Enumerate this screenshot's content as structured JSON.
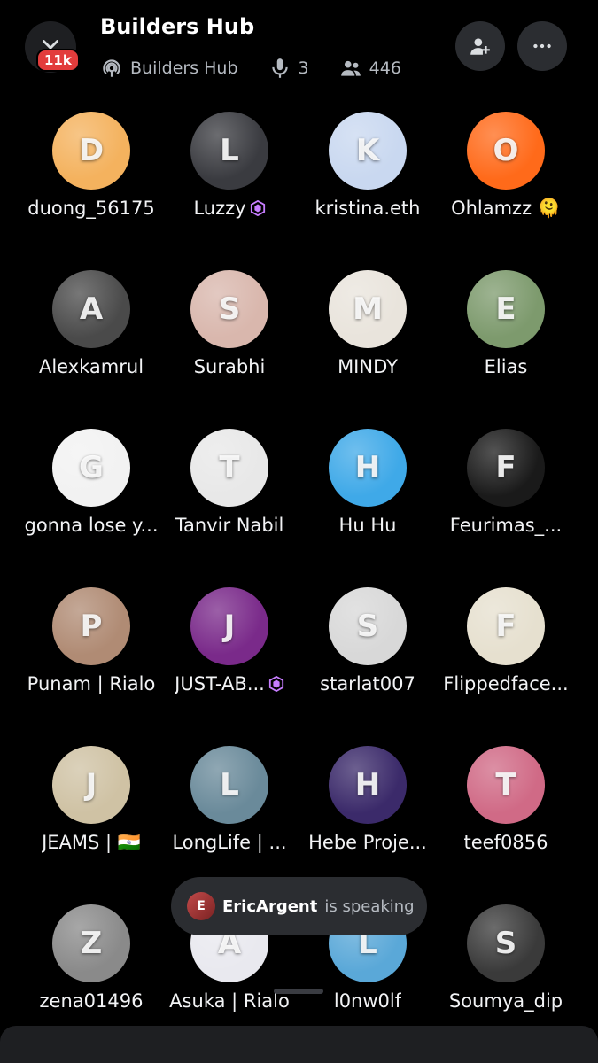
{
  "header": {
    "title": "Builders Hub",
    "badge": "11k",
    "stage_name": "Builders Hub",
    "speaker_count": "3",
    "listener_count": "446"
  },
  "participants": [
    {
      "name": "duong_56175",
      "color": "#f4b25e",
      "initial": "D",
      "nitro": false
    },
    {
      "name": "Luzzy",
      "color": "#3a3b40",
      "initial": "L",
      "nitro": true
    },
    {
      "name": "kristina.eth",
      "color": "#c9d8f0",
      "initial": "K",
      "nitro": false
    },
    {
      "name": "Ohlamzz 🫠",
      "color": "#ff6a1a",
      "initial": "O",
      "nitro": false
    },
    {
      "name": "Alexkamrul",
      "color": "#4a4a4a",
      "initial": "A",
      "nitro": false
    },
    {
      "name": "Surabhi",
      "color": "#d9b7ad",
      "initial": "S",
      "nitro": false
    },
    {
      "name": "MINDY",
      "color": "#e9e4dc",
      "initial": "M",
      "nitro": false
    },
    {
      "name": "Elias",
      "color": "#7d9a6d",
      "initial": "E",
      "nitro": false
    },
    {
      "name": "gonna lose y...",
      "color": "#f2f2f2",
      "initial": "G",
      "nitro": false
    },
    {
      "name": "Tanvir Nabil",
      "color": "#e8e8e8",
      "initial": "T",
      "nitro": false
    },
    {
      "name": "Hu Hu",
      "color": "#3fa9e8",
      "initial": "H",
      "nitro": false
    },
    {
      "name": "Feurimas_...",
      "color": "#1a1a1a",
      "initial": "F",
      "nitro": false
    },
    {
      "name": "Punam | Rialo",
      "color": "#b08b74",
      "initial": "P",
      "nitro": false
    },
    {
      "name": "JUST-AB...",
      "color": "#7a2a8a",
      "initial": "J",
      "nitro": true
    },
    {
      "name": "starlat007",
      "color": "#d8d8d8",
      "initial": "S",
      "nitro": false
    },
    {
      "name": "Flippedface...",
      "color": "#e6e0cf",
      "initial": "F",
      "nitro": false
    },
    {
      "name": "JEAMS  |  🇮🇳",
      "color": "#cfc2a4",
      "initial": "J",
      "nitro": false
    },
    {
      "name": "LongLife | ...",
      "color": "#6a8a9a",
      "initial": "L",
      "nitro": false
    },
    {
      "name": "Hebe Proje...",
      "color": "#3b2a6a",
      "initial": "H",
      "nitro": false
    },
    {
      "name": "teef0856",
      "color": "#d06a86",
      "initial": "T",
      "nitro": false
    },
    {
      "name": "zena01496",
      "color": "#8a8a8a",
      "initial": "Z",
      "nitro": false
    },
    {
      "name": "Asuka | Rialo",
      "color": "#e9e9ef",
      "initial": "A",
      "nitro": false
    },
    {
      "name": "l0nw0lf",
      "color": "#5aa8d8",
      "initial": "L",
      "nitro": false
    },
    {
      "name": "Soumya_dip",
      "color": "#3a3a3a",
      "initial": "S",
      "nitro": false
    }
  ],
  "speaking": {
    "initial": "E",
    "user": "EricArgent",
    "status": "is speaking"
  },
  "colors": {
    "background": "#000000",
    "nitro": "#c77dff",
    "badge": "#e23c3c"
  }
}
